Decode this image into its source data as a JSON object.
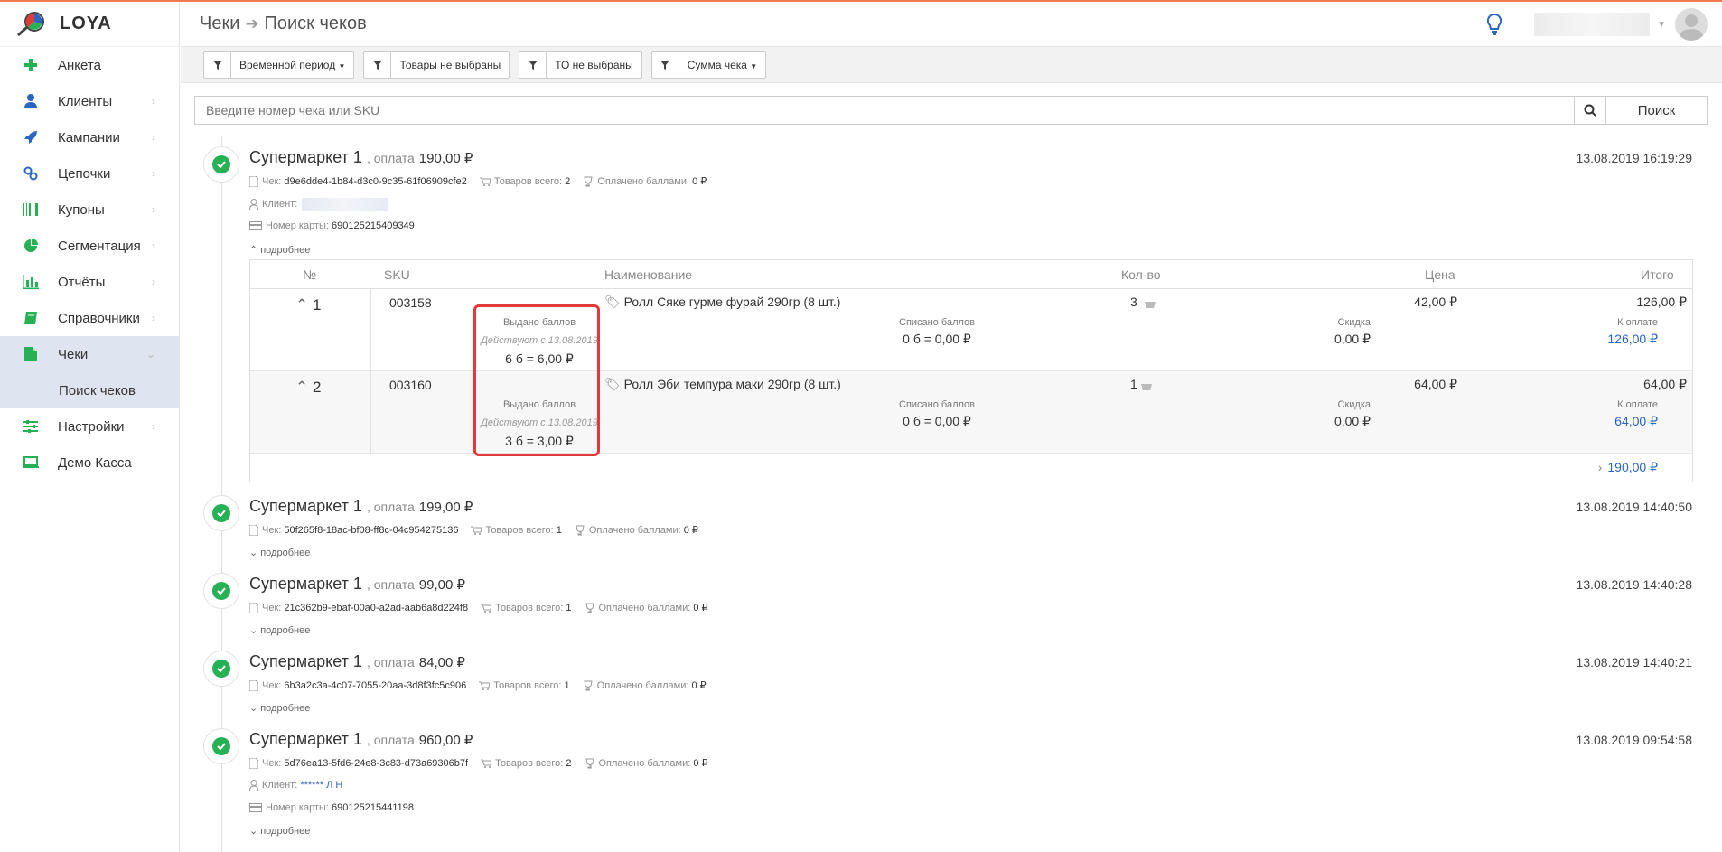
{
  "app": {
    "logo_text": "LOYA"
  },
  "sidebar": {
    "items": [
      {
        "label": "Анкета",
        "icon": "plus-icon",
        "color": "#27b155"
      },
      {
        "label": "Клиенты",
        "icon": "user-icon",
        "color": "#2b65c2"
      },
      {
        "label": "Кампании",
        "icon": "rocket-icon",
        "color": "#2b65c2"
      },
      {
        "label": "Цепочки",
        "icon": "link-icon",
        "color": "#2b65c2"
      },
      {
        "label": "Купоны",
        "icon": "barcode-icon",
        "color": "#27b155"
      },
      {
        "label": "Сегментация",
        "icon": "pie-chart-icon",
        "color": "#27b155"
      },
      {
        "label": "Отчёты",
        "icon": "bar-chart-icon",
        "color": "#27b155"
      },
      {
        "label": "Справочники",
        "icon": "book-icon",
        "color": "#27b155"
      },
      {
        "label": "Чеки",
        "icon": "document-icon",
        "color": "#27b155"
      },
      {
        "label": "Поиск чеков"
      },
      {
        "label": "Настройки",
        "icon": "sliders-icon",
        "color": "#27b155"
      },
      {
        "label": "Демо Касса",
        "icon": "laptop-icon",
        "color": "#27b155"
      }
    ]
  },
  "header": {
    "crumb_parent": "Чеки",
    "crumb_current": "Поиск чеков"
  },
  "filters": [
    {
      "label": "Временной период"
    },
    {
      "label": "Товары не выбраны"
    },
    {
      "label": "ТО не выбраны"
    },
    {
      "label": "Сумма чека"
    }
  ],
  "search": {
    "placeholder": "Введите номер чека или SKU",
    "button": "Поиск"
  },
  "labels": {
    "pay": ", оплата",
    "check": "Чек:",
    "goods_total": "Товаров всего:",
    "paid_points": "Оплачено баллами:",
    "client": "Клиент:",
    "card_number": "Номер карты:",
    "more": "подробнее"
  },
  "receipts": [
    {
      "store": "Супермаркет 1",
      "amount": "190,00 ₽",
      "date": "13.08.2019 16:19:29",
      "check_id": "d9e6dde4-1b84-d3c0-9c35-61f06909cfe2",
      "goods": "2",
      "points": "0 ₽",
      "card": "690125215409349"
    },
    {
      "store": "Супермаркет 1",
      "amount": "199,00 ₽",
      "date": "13.08.2019 14:40:50",
      "check_id": "50f265f8-18ac-bf08-ff8c-04c954275136",
      "goods": "1",
      "points": "0 ₽"
    },
    {
      "store": "Супермаркет 1",
      "amount": "99,00 ₽",
      "date": "13.08.2019 14:40:28",
      "check_id": "21c362b9-ebaf-00a0-a2ad-aab6a8d224f8",
      "goods": "1",
      "points": "0 ₽"
    },
    {
      "store": "Супермаркет 1",
      "amount": "84,00 ₽",
      "date": "13.08.2019 14:40:21",
      "check_id": "6b3a2c3a-4c07-7055-20aa-3d8f3fc5c906",
      "goods": "1",
      "points": "0 ₽"
    },
    {
      "store": "Супермаркет 1",
      "amount": "960,00 ₽",
      "date": "13.08.2019 09:54:58",
      "check_id": "5d76ea13-5fd6-24e8-3c83-d73a69306b7f",
      "goods": "2",
      "points": "0 ₽",
      "client": "****** Л Н",
      "card": "690125215441198"
    }
  ],
  "items_table": {
    "headers": [
      "№",
      "SKU",
      "Наименование",
      "Кол-во",
      "Цена",
      "Итого"
    ],
    "labels": {
      "issued": "Выдано баллов",
      "written_off": "Списано баллов",
      "discount": "Скидка",
      "to_pay": "К оплате"
    },
    "rows": [
      {
        "num": "1",
        "sku": "003158",
        "issued_valid": "Действуют с 13.08.2019",
        "issued_value": "6 б = 6,00 ₽",
        "name": "Ролл Сяке гурме фурай 290гр (8 шт.)",
        "qty": "3",
        "price": "42,00 ₽",
        "total": "126,00 ₽",
        "written_off": "0 б = 0,00 ₽",
        "discount": "0,00 ₽",
        "to_pay": "126,00 ₽"
      },
      {
        "num": "2",
        "sku": "003160",
        "issued_valid": "Действуют с 13.08.2019",
        "issued_value": "3 б = 3,00 ₽",
        "name": "Ролл Эби темпура маки 290гр (8 шт.)",
        "qty": "1",
        "price": "64,00 ₽",
        "total": "64,00 ₽",
        "written_off": "0 б = 0,00 ₽",
        "discount": "0,00 ₽",
        "to_pay": "64,00 ₽"
      }
    ],
    "footer_total": "190,00 ₽"
  }
}
